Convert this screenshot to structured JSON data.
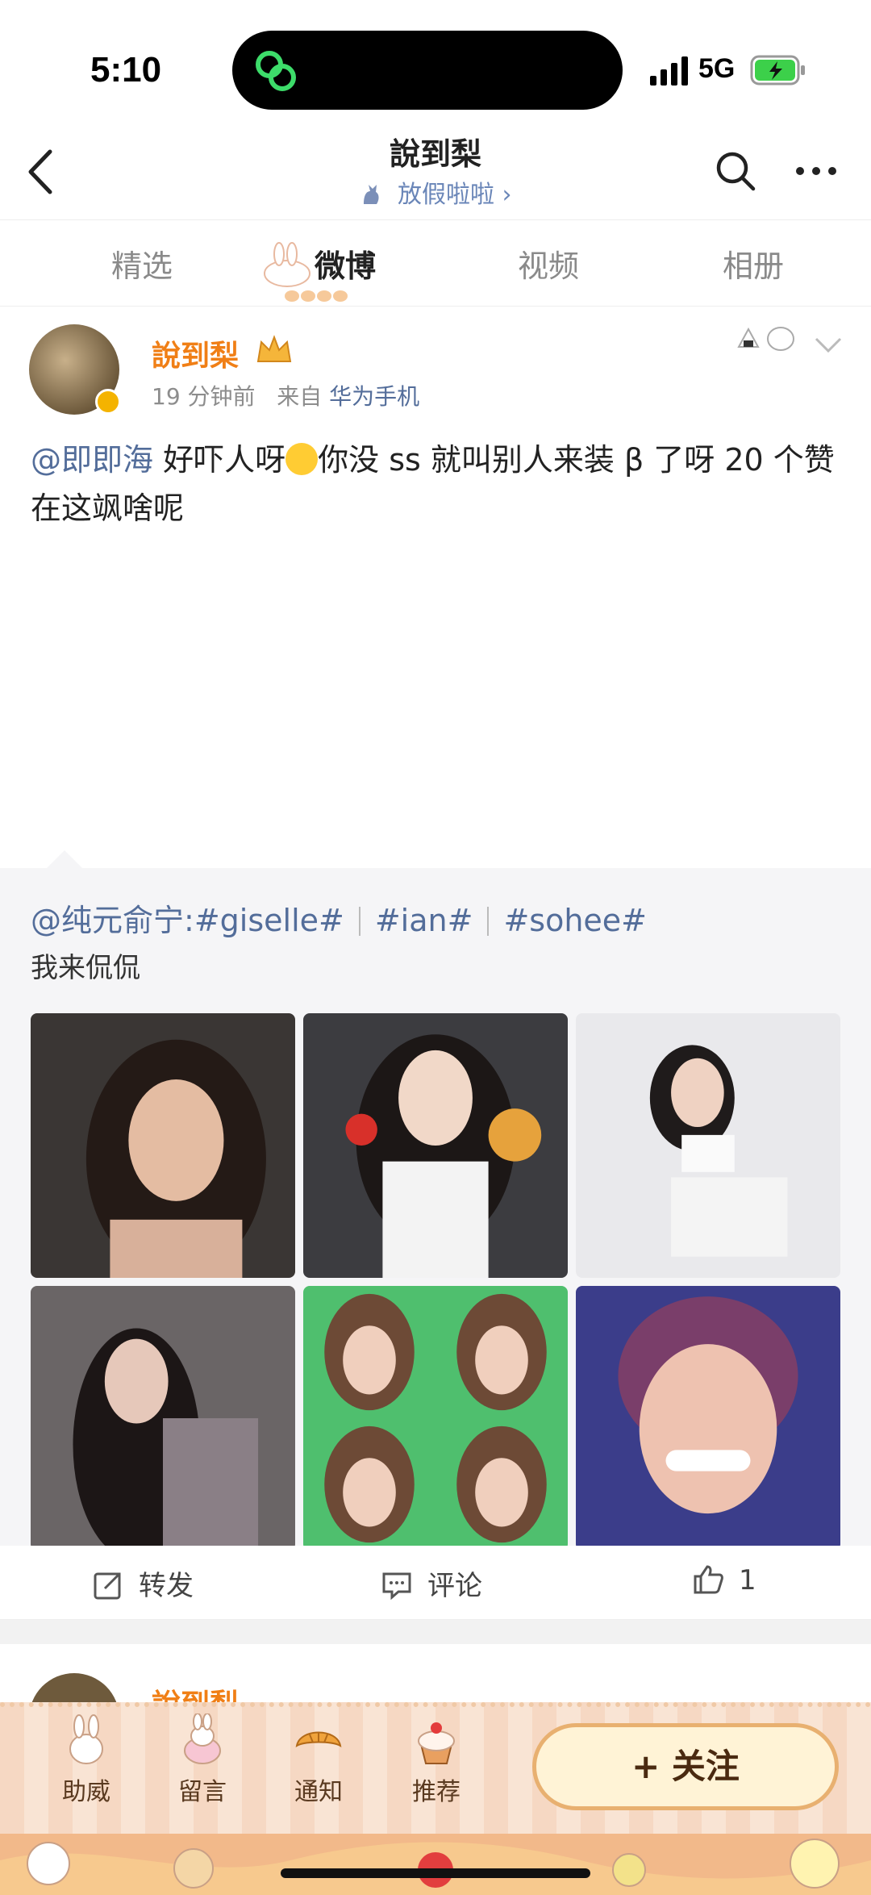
{
  "status_bar": {
    "time": "5:10",
    "network": "5G"
  },
  "header": {
    "title": "說到梨",
    "subtitle": "放假啦啦 ›"
  },
  "tabs": [
    {
      "label": "精选",
      "active": false
    },
    {
      "label": "微博",
      "active": true
    },
    {
      "label": "视频",
      "active": false
    },
    {
      "label": "相册",
      "active": false
    }
  ],
  "post": {
    "author": "說到梨",
    "time_ago": "19 分钟前",
    "source_prefix": "来自",
    "source_device": "华为手机",
    "mention": "@即即海",
    "text_part1": " 好吓人呀",
    "text_part2": "你没 ss 就叫别人来装 β 了呀 20 个赞在这飒啥呢"
  },
  "repost": {
    "mention": "@纯元俞宁:",
    "tags": [
      "#giselle#",
      "#ian#",
      "#sohee#"
    ],
    "text": "我来侃侃"
  },
  "actions": {
    "repost": "转发",
    "comment": "评论",
    "like": "1"
  },
  "next_post": {
    "author": "說到梨"
  },
  "bottom_bar": {
    "items": [
      "助威",
      "留言",
      "通知",
      "推荐"
    ],
    "follow": "+ 关注"
  },
  "colors": {
    "author": "#f07f16",
    "link": "#536d9a",
    "repost_bg": "#f5f5f7"
  }
}
